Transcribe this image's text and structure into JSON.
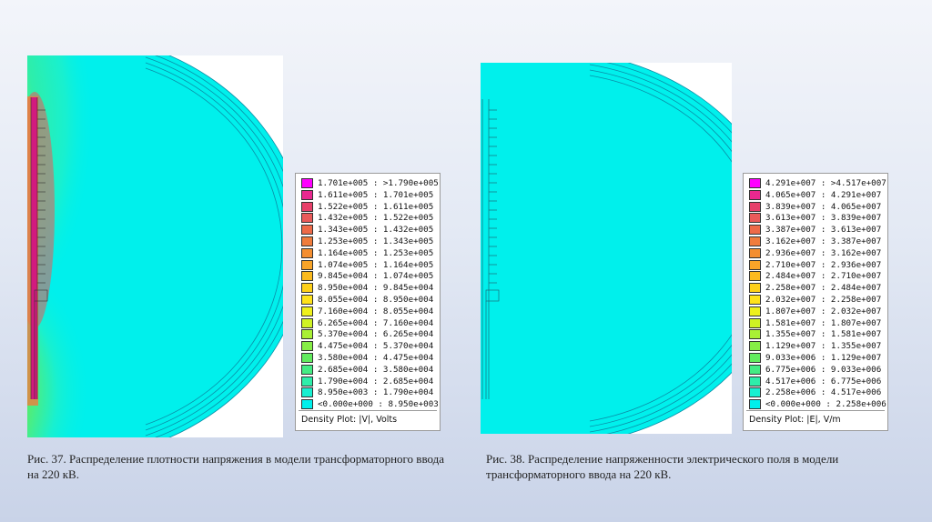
{
  "left_figure": {
    "legend_title": "Density Plot: |V|, Volts",
    "legend": [
      {
        "label": "1.701e+005 : >1.790e+005",
        "color": "#ff00ff"
      },
      {
        "label": "1.611e+005 : 1.701e+005",
        "color": "#e8288f"
      },
      {
        "label": "1.522e+005 : 1.611e+005",
        "color": "#e8406a"
      },
      {
        "label": "1.432e+005 : 1.522e+005",
        "color": "#ea5a5a"
      },
      {
        "label": "1.343e+005 : 1.432e+005",
        "color": "#ee6a48"
      },
      {
        "label": "1.253e+005 : 1.343e+005",
        "color": "#f07c3c"
      },
      {
        "label": "1.164e+005 : 1.253e+005",
        "color": "#f48e30"
      },
      {
        "label": "1.074e+005 : 1.164e+005",
        "color": "#f8a428"
      },
      {
        "label": "9.845e+004 : 1.074e+005",
        "color": "#fbba1e"
      },
      {
        "label": "8.950e+004 : 9.845e+004",
        "color": "#fed018"
      },
      {
        "label": "8.055e+004 : 8.950e+004",
        "color": "#fee21a"
      },
      {
        "label": "7.160e+004 : 8.055e+004",
        "color": "#eef01c"
      },
      {
        "label": "6.265e+004 : 7.160e+004",
        "color": "#cff224"
      },
      {
        "label": "5.370e+004 : 6.265e+004",
        "color": "#a9f034"
      },
      {
        "label": "4.475e+004 : 5.370e+004",
        "color": "#86ee46"
      },
      {
        "label": "3.580e+004 : 4.475e+004",
        "color": "#62ec5e"
      },
      {
        "label": "2.685e+004 : 3.580e+004",
        "color": "#44ec84"
      },
      {
        "label": "1.790e+004 : 2.685e+004",
        "color": "#2eeeaa"
      },
      {
        "label": "8.950e+003 : 1.790e+004",
        "color": "#18f0d0"
      },
      {
        "label": "<0.000e+000 : 8.950e+003",
        "color": "#00f0ec"
      }
    ],
    "caption": "Рис. 37. Распределение плотности напряжения в модели трансформаторного ввода на 220 кВ."
  },
  "right_figure": {
    "legend_title": "Density Plot: |E|, V/m",
    "legend": [
      {
        "label": "4.291e+007 : >4.517e+007",
        "color": "#ff00ff"
      },
      {
        "label": "4.065e+007 : 4.291e+007",
        "color": "#e8288f"
      },
      {
        "label": "3.839e+007 : 4.065e+007",
        "color": "#e8406a"
      },
      {
        "label": "3.613e+007 : 3.839e+007",
        "color": "#ea5a5a"
      },
      {
        "label": "3.387e+007 : 3.613e+007",
        "color": "#ee6a48"
      },
      {
        "label": "3.162e+007 : 3.387e+007",
        "color": "#f07c3c"
      },
      {
        "label": "2.936e+007 : 3.162e+007",
        "color": "#f48e30"
      },
      {
        "label": "2.710e+007 : 2.936e+007",
        "color": "#f8a428"
      },
      {
        "label": "2.484e+007 : 2.710e+007",
        "color": "#fbba1e"
      },
      {
        "label": "2.258e+007 : 2.484e+007",
        "color": "#fed018"
      },
      {
        "label": "2.032e+007 : 2.258e+007",
        "color": "#fee21a"
      },
      {
        "label": "1.807e+007 : 2.032e+007",
        "color": "#eef01c"
      },
      {
        "label": "1.581e+007 : 1.807e+007",
        "color": "#cff224"
      },
      {
        "label": "1.355e+007 : 1.581e+007",
        "color": "#a9f034"
      },
      {
        "label": "1.129e+007 : 1.355e+007",
        "color": "#86ee46"
      },
      {
        "label": "9.033e+006 : 1.129e+007",
        "color": "#62ec5e"
      },
      {
        "label": "6.775e+006 : 9.033e+006",
        "color": "#44ec84"
      },
      {
        "label": "4.517e+006 : 6.775e+006",
        "color": "#2eeeaa"
      },
      {
        "label": "2.258e+006 : 4.517e+006",
        "color": "#18f0d0"
      },
      {
        "label": "<0.000e+000 : 2.258e+006",
        "color": "#00f0ec"
      }
    ],
    "caption": "Рис. 38. Распределение напряженности электрического поля в модели трансформаторного ввода на 220 кВ."
  }
}
